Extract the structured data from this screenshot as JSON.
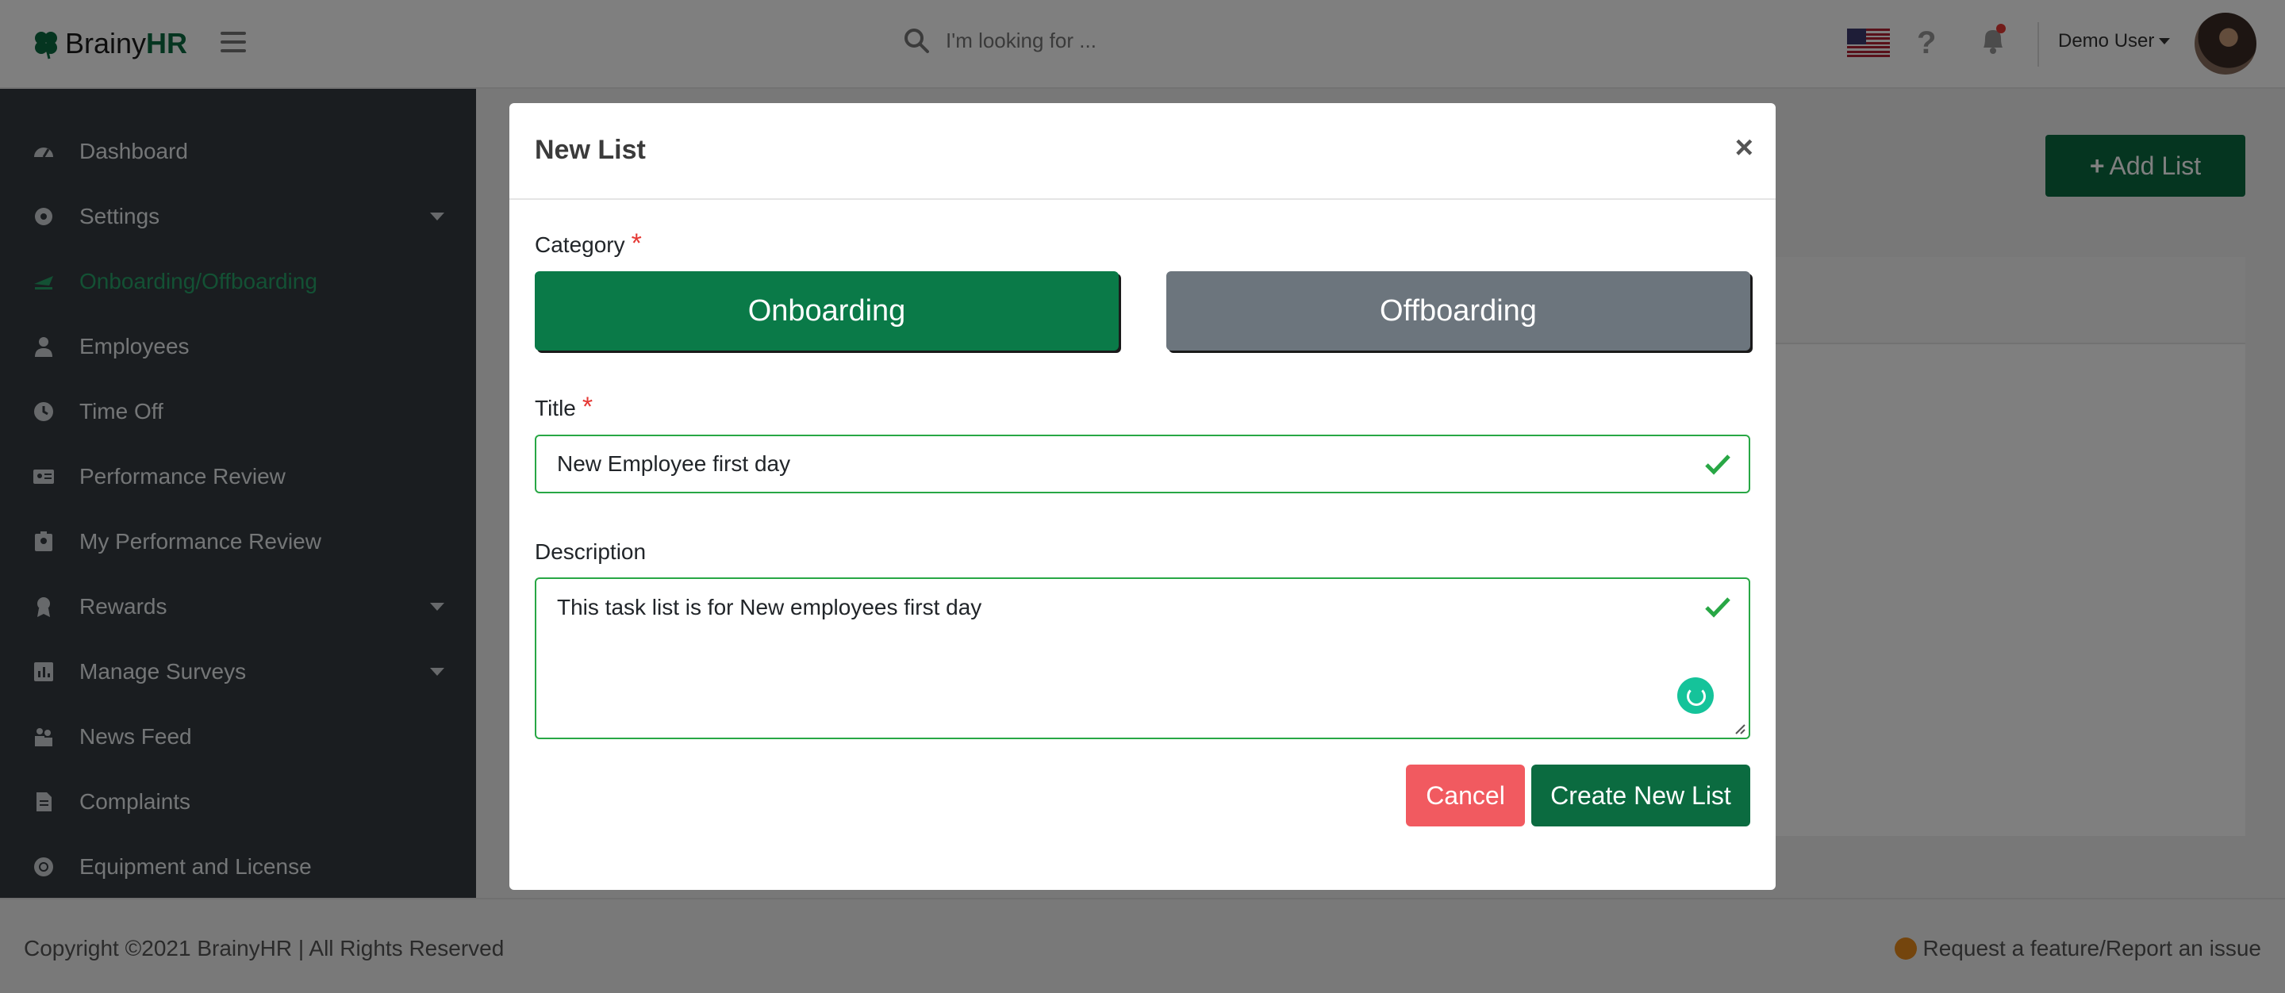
{
  "header": {
    "logo_brainy": "Brainy",
    "logo_hr": "HR",
    "search_placeholder": "I'm looking for ...",
    "user_name": "Demo User"
  },
  "sidebar": {
    "items": [
      {
        "label": "Dashboard",
        "icon": "dashboard-icon"
      },
      {
        "label": "Settings",
        "icon": "gear-icon",
        "has_submenu": true
      },
      {
        "label": "Onboarding/Offboarding",
        "icon": "plane-icon",
        "active": true
      },
      {
        "label": "Employees",
        "icon": "user-icon"
      },
      {
        "label": "Time Off",
        "icon": "clock-icon"
      },
      {
        "label": "Performance Review",
        "icon": "id-card-icon"
      },
      {
        "label": "My Performance Review",
        "icon": "id-badge-icon"
      },
      {
        "label": "Rewards",
        "icon": "award-icon",
        "has_submenu": true
      },
      {
        "label": "Manage Surveys",
        "icon": "chart-icon",
        "has_submenu": true
      },
      {
        "label": "News Feed",
        "icon": "people-icon"
      },
      {
        "label": "Complaints",
        "icon": "file-icon"
      },
      {
        "label": "Equipment and License",
        "icon": "cog-icon"
      }
    ]
  },
  "main": {
    "add_list_label": "Add List"
  },
  "modal": {
    "title": "New List",
    "close": "×",
    "category_label": "Category",
    "required_mark": "*",
    "onboarding_label": "Onboarding",
    "offboarding_label": "Offboarding",
    "selected_category": "Onboarding",
    "title_label": "Title",
    "title_value": "New Employee first day",
    "description_label": "Description",
    "description_value": "This task list is for New employees first day",
    "cancel_label": "Cancel",
    "create_label": "Create New List"
  },
  "footer": {
    "copyright": "Copyright ©2021 BrainyHR | All Rights Reserved",
    "report_link": "Request a feature/Report an issue"
  },
  "colors": {
    "brand_green": "#0b6b40",
    "valid_green": "#28a745",
    "danger": "#f15a60",
    "sidebar_bg": "#343a40",
    "secondary": "#6c757d"
  }
}
